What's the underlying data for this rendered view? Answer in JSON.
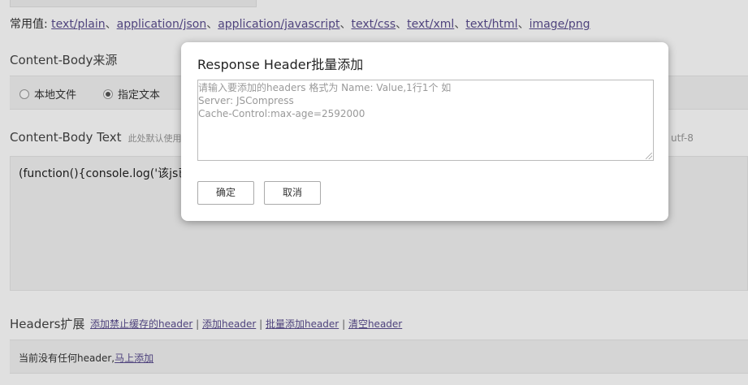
{
  "common_values": {
    "label": "常用值:",
    "types": [
      "text/plain",
      "application/json",
      "application/javascript",
      "text/css",
      "text/xml",
      "text/html",
      "image/png"
    ],
    "separator": "、"
  },
  "content_body_source": {
    "title": "Content-Body来源",
    "options": [
      {
        "label": "本地文件",
        "checked": false
      },
      {
        "label": "指定文本",
        "checked": true
      }
    ]
  },
  "content_body_text": {
    "title": "Content-Body Text",
    "hint": "此处默认使用",
    "charset": "utf-8",
    "value": "(function(){console.log('该js已"
  },
  "headers_ext": {
    "title": "Headers扩展",
    "links": [
      "添加禁止缓存的header",
      "添加header",
      "批量添加header",
      "清空header"
    ],
    "link_sep": "|",
    "empty_text": "当前没有任何header,",
    "add_now": "马上添加"
  },
  "modal": {
    "title": "Response Header批量添加",
    "placeholder": "请输入要添加的headers 格式为 Name: Value,1行1个 如\nServer: JSCompress\nCache-Control:max-age=2592000",
    "confirm": "确定",
    "cancel": "取消"
  }
}
